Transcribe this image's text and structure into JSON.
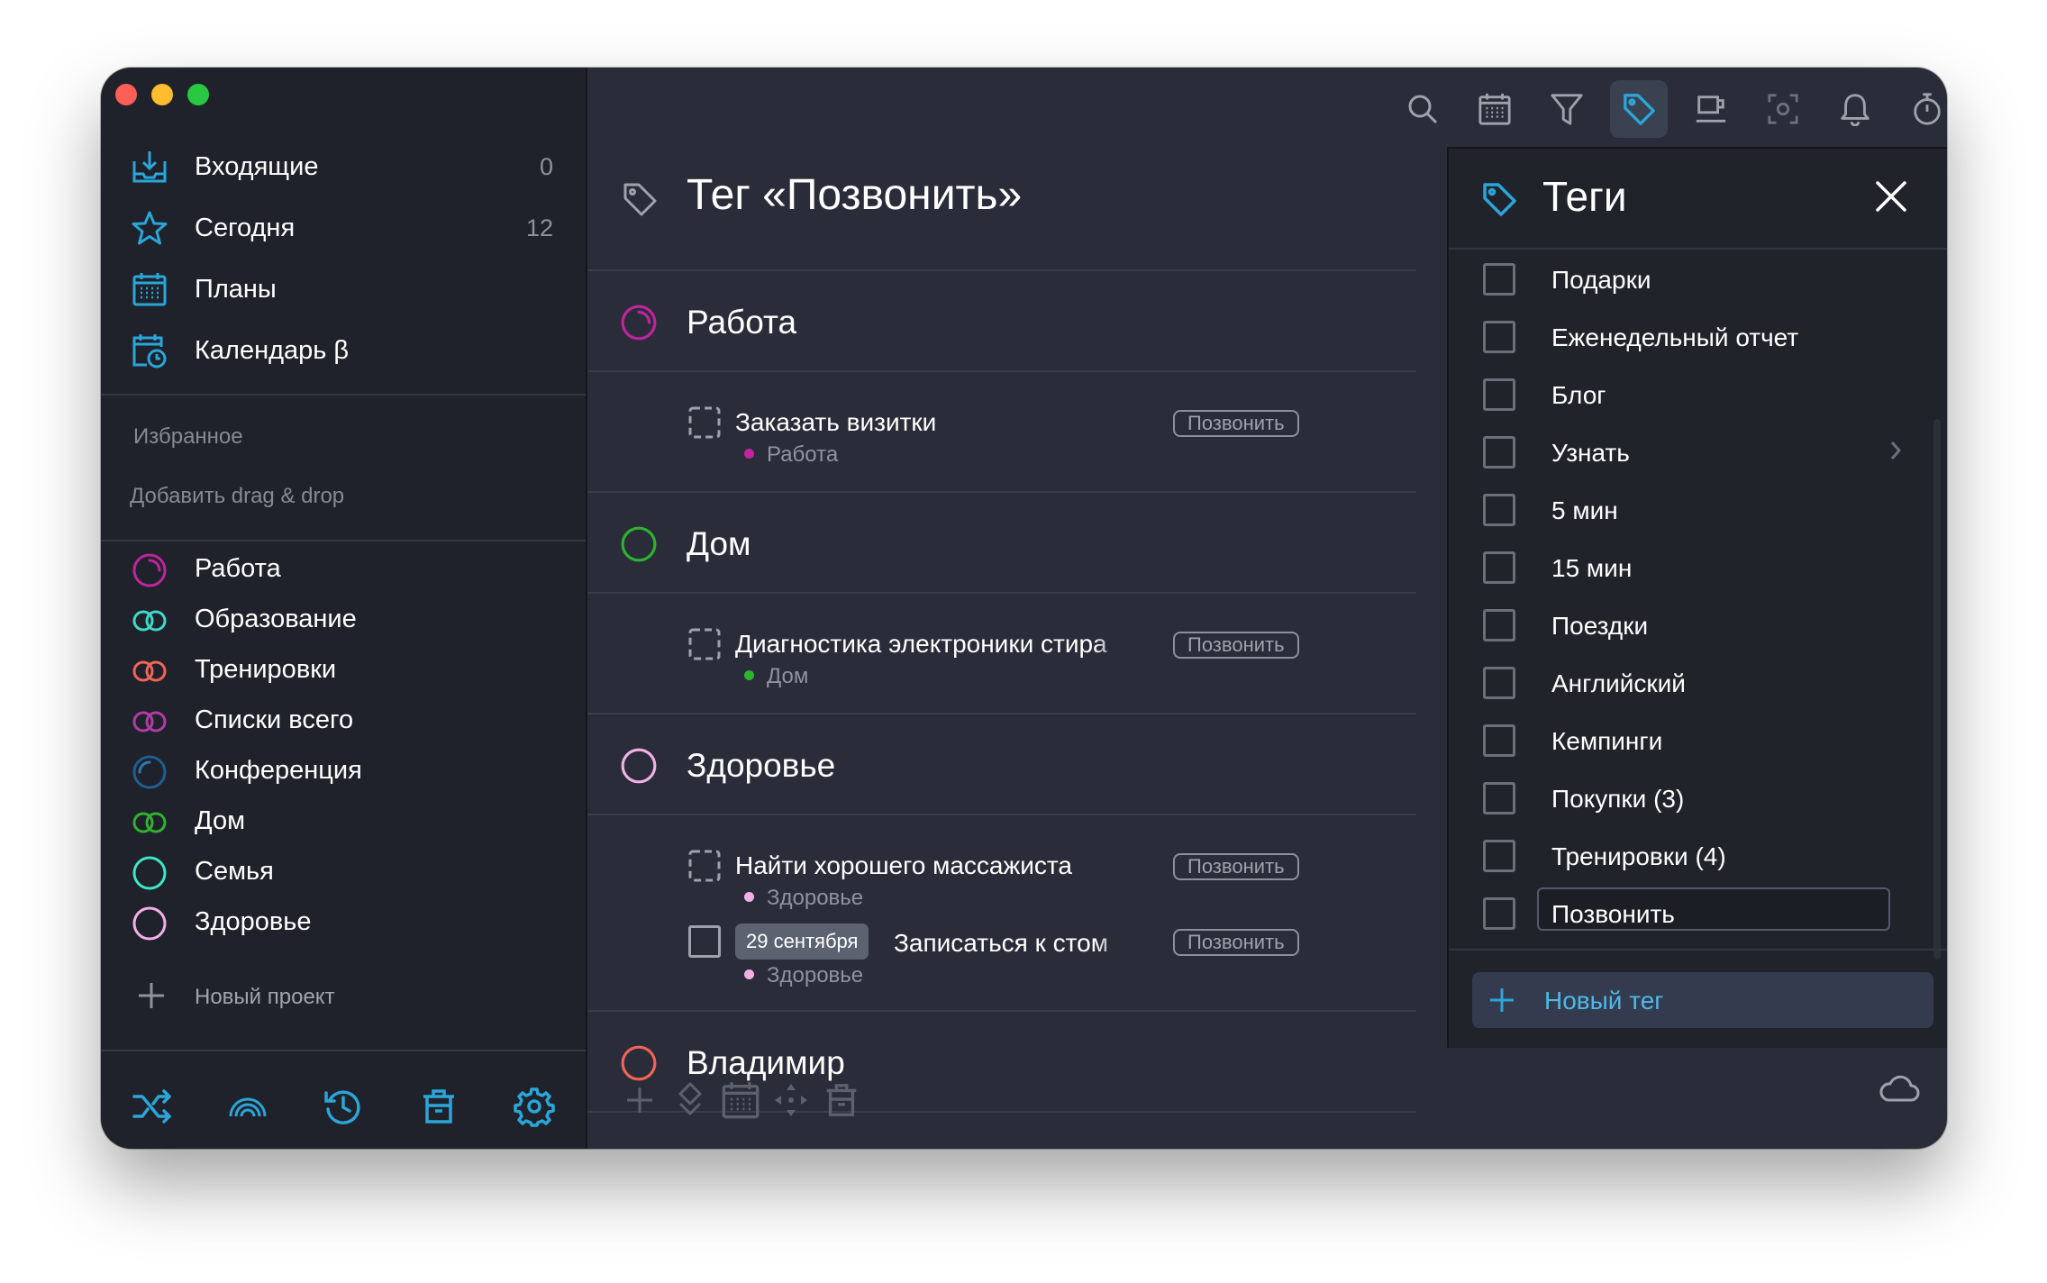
{
  "sidebar": {
    "nav": [
      {
        "label": "Входящие",
        "count": "0",
        "icon": "inbox-icon"
      },
      {
        "label": "Сегодня",
        "count": "12",
        "icon": "star-icon"
      },
      {
        "label": "Планы",
        "count": "",
        "icon": "calendar-grid-icon"
      },
      {
        "label": "Календарь β",
        "count": "",
        "icon": "calendar-clock-icon"
      }
    ],
    "favorites_title": "Избранное",
    "favorites_hint": "Добавить drag & drop",
    "projects": [
      {
        "label": "Работа",
        "icon": "progress-ring-icon",
        "color": "#c0249e"
      },
      {
        "label": "Образование",
        "icon": "double-ring-icon",
        "color": "#3ed9c9"
      },
      {
        "label": "Тренировки",
        "icon": "double-ring-icon",
        "color": "#f26458"
      },
      {
        "label": "Списки всего",
        "icon": "double-ring-icon",
        "color": "#b43aa8"
      },
      {
        "label": "Конференция",
        "icon": "progress-ring-icon",
        "color": "#2a7ab8"
      },
      {
        "label": "Дом",
        "icon": "double-ring-icon",
        "color": "#2db32d"
      },
      {
        "label": "Семья",
        "icon": "ring-icon",
        "color": "#3ee6c8"
      },
      {
        "label": "Здоровье",
        "icon": "ring-icon",
        "color": "#f3b0e6"
      }
    ],
    "new_project": "Новый проект",
    "bottom_icons": [
      "shuffle-icon",
      "rainbow-icon",
      "history-icon",
      "trash-icon",
      "gear-icon"
    ]
  },
  "toolbar": {
    "icons": [
      "search-icon",
      "calendar-icon",
      "filter-icon",
      "tag-icon",
      "coffee-icon",
      "focus-icon",
      "bell-icon",
      "timer-icon",
      "windows-icon"
    ],
    "active": "tag-icon"
  },
  "main": {
    "title": "Тег «Позвонить»",
    "sections": [
      {
        "title": "Работа",
        "color": "#c0249e",
        "tasks": [
          {
            "title": "Заказать визитки",
            "project": "Работа",
            "dot": "#c0249e",
            "tag": "Позвонить"
          }
        ]
      },
      {
        "title": "Дом",
        "color": "#2db32d",
        "tasks": [
          {
            "title": "Диагностика электроники стира",
            "project": "Дом",
            "dot": "#2db32d",
            "tag": "Позвонить"
          }
        ]
      },
      {
        "title": "Здоровье",
        "color": "#f3b0e6",
        "tasks": [
          {
            "title": "Найти хорошего массажиста",
            "project": "Здоровье",
            "dot": "#f3b0e6",
            "tag": "Позвонить"
          },
          {
            "date": "29 сентября",
            "title": "Записаться к стом",
            "project": "Здоровье",
            "dot": "#f3b0e6",
            "tag": "Позвонить"
          }
        ]
      },
      {
        "title": "Владимир",
        "color": "#f26458",
        "tasks": []
      }
    ],
    "bottom_icons": [
      "add-icon",
      "move-icon",
      "calendar-icon",
      "arrows-icon",
      "trash-icon"
    ],
    "cloud_icon": "cloud-icon"
  },
  "tags_panel": {
    "title": "Теги",
    "items": [
      "Подарки",
      "Еженедельный отчет",
      "Блог",
      "Узнать",
      "5 мин",
      "15 мин",
      "Поездки",
      "Английский",
      "Кемпинги",
      "Покупки (3)",
      "Тренировки (4)",
      "Позвонить"
    ],
    "new_tag": "Новый тег"
  },
  "colors": {
    "accent": "#2aa6d8",
    "window_bg": "#2a2d39",
    "sidebar_bg": "#20222b"
  }
}
